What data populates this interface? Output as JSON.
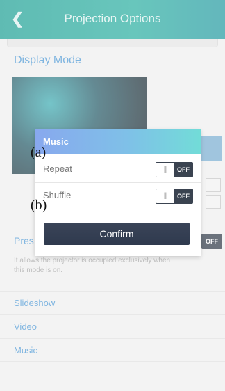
{
  "header": {
    "title": "Projection Options",
    "back_glyph": "❮",
    "back_icon": "chevron-left-icon"
  },
  "section": {
    "title": "Display Mode"
  },
  "exclusive_mode": {
    "label_visible": "Pres",
    "state": "OFF",
    "description": "It allows the projector is occupied exclusively when this mode is on."
  },
  "list": {
    "items": [
      "Slideshow",
      "Video",
      "Music"
    ]
  },
  "dialog": {
    "title": "Music",
    "options": [
      {
        "label": "Repeat",
        "knob": "|||",
        "state": "OFF"
      },
      {
        "label": "Shuffle",
        "knob": "|||",
        "state": "OFF"
      }
    ],
    "confirm_label": "Confirm"
  },
  "annotations": {
    "a": "(a)",
    "b": "(b)"
  }
}
